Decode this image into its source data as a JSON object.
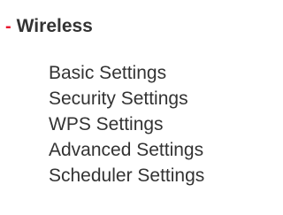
{
  "section": {
    "icon": "minus-icon",
    "collapse_symbol": "-",
    "title": "Wireless",
    "accent_color": "#e8112d",
    "text_color": "#333333"
  },
  "submenu": {
    "items": [
      {
        "label": "Basic Settings"
      },
      {
        "label": "Security Settings"
      },
      {
        "label": "WPS Settings"
      },
      {
        "label": "Advanced Settings"
      },
      {
        "label": "Scheduler Settings"
      }
    ]
  }
}
